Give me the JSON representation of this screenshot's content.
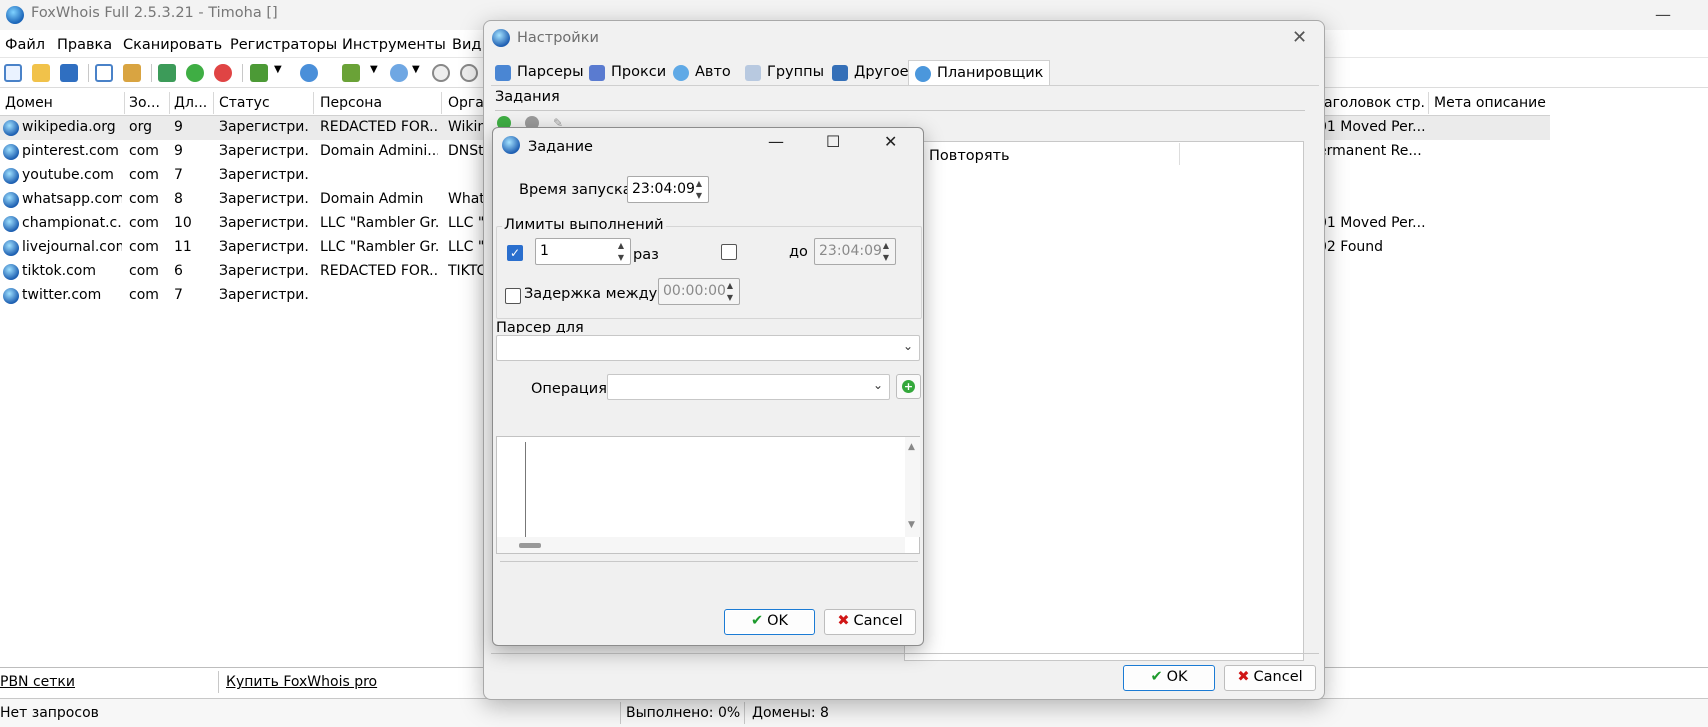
{
  "app": {
    "title": "FoxWhois Full 2.5.3.21 - Timoha []",
    "minimize_glyph": "—"
  },
  "menu": [
    "Файл",
    "Правка",
    "Сканировать",
    "Регистраторы",
    "Инструменты",
    "Вид"
  ],
  "grid": {
    "columns": [
      "Домен",
      "Зо...",
      "Дл...",
      "Статус",
      "Персона",
      "Орга",
      "аголовок стр...",
      "Мета описание"
    ],
    "rows": [
      {
        "domain": "wikipedia.org",
        "zone": "org",
        "len": "9",
        "status": "Зарегистри...",
        "person": "REDACTED FOR...",
        "org": "Wikin",
        "title": "01 Moved Per..."
      },
      {
        "domain": "pinterest.com",
        "zone": "com",
        "len": "9",
        "status": "Зарегистри...",
        "person": "Domain Admini...",
        "org": "DNSt",
        "title": "ermanent Re..."
      },
      {
        "domain": "youtube.com",
        "zone": "com",
        "len": "7",
        "status": "Зарегистри...",
        "person": "",
        "org": "",
        "title": ""
      },
      {
        "domain": "whatsapp.com",
        "zone": "com",
        "len": "8",
        "status": "Зарегистри...",
        "person": "Domain Admin",
        "org": "What",
        "title": ""
      },
      {
        "domain": "championat.c...",
        "zone": "com",
        "len": "10",
        "status": "Зарегистри...",
        "person": "LLC \"Rambler Gr...",
        "org": "LLC \"I",
        "title": "01 Moved Per..."
      },
      {
        "domain": "livejournal.com",
        "zone": "com",
        "len": "11",
        "status": "Зарегистри...",
        "person": "LLC \"Rambler Gr...",
        "org": "LLC \"I",
        "title": "02 Found"
      },
      {
        "domain": "tiktok.com",
        "zone": "com",
        "len": "6",
        "status": "Зарегистри...",
        "person": "REDACTED FOR...",
        "org": "TIKTC",
        "title": ""
      },
      {
        "domain": "twitter.com",
        "zone": "com",
        "len": "7",
        "status": "Зарегистри...",
        "person": "",
        "org": "",
        "title": ""
      }
    ]
  },
  "bottom_links": {
    "left": "PBN сетки",
    "right": "Купить FoxWhois pro"
  },
  "status": {
    "requests": "Нет запросов",
    "done": "Выполнено: 0%",
    "domains": "Домены: 8"
  },
  "settings": {
    "title": "Настройки",
    "close_glyph": "✕",
    "tabs": [
      "Парсеры",
      "Прокси",
      "Авто",
      "Группы",
      "Другое",
      "Планировщик"
    ],
    "active_tab": "Планировщик",
    "jobs_label": "Задания",
    "list_column": "Повторять",
    "ok": "OK",
    "cancel": "Cancel"
  },
  "task": {
    "title": "Задание",
    "start_time_label": "Время запуска",
    "start_time": "23:04:09",
    "limits_label": "Лимиты выполнений",
    "count_value": "1",
    "count_unit": "раз",
    "until_label": "до",
    "until_value": "23:04:09",
    "delay_label": "Задержка между",
    "delay_value": "00:00:00",
    "parser_label": "Парсер для",
    "operation_label": "Операция",
    "ok": "OK",
    "cancel": "Cancel",
    "win_minimize": "—",
    "win_maximize": "☐",
    "win_close": "✕"
  }
}
